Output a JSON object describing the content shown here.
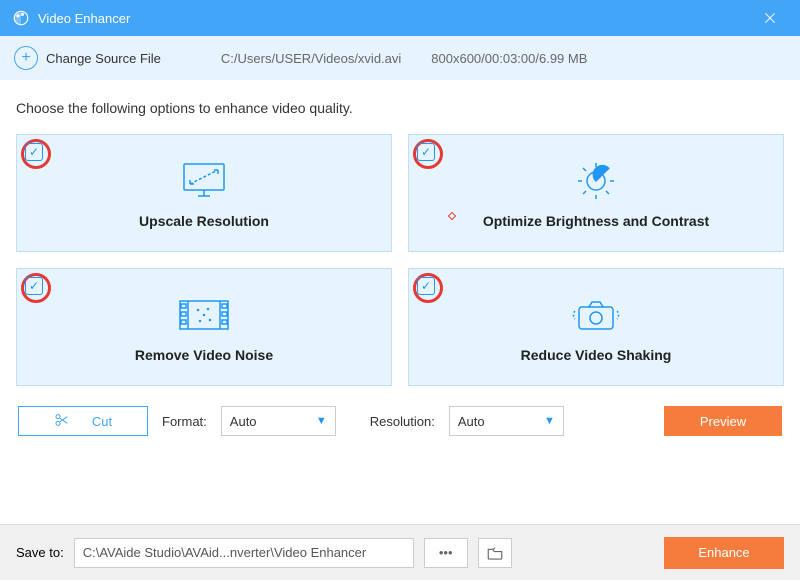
{
  "titlebar": {
    "title": "Video Enhancer"
  },
  "toolbar": {
    "change_source": "Change Source File",
    "filepath": "C:/Users/USER/Videos/xvid.avi",
    "fileinfo": "800x600/00:03:00/6.99 MB"
  },
  "instruction": "Choose the following options to enhance video quality.",
  "cards": {
    "upscale": "Upscale Resolution",
    "brightness": "Optimize Brightness and Contrast",
    "noise": "Remove Video Noise",
    "shaking": "Reduce Video Shaking"
  },
  "controls": {
    "cut": "Cut",
    "format_label": "Format:",
    "format_value": "Auto",
    "resolution_label": "Resolution:",
    "resolution_value": "Auto",
    "preview": "Preview"
  },
  "footer": {
    "save_label": "Save to:",
    "save_path": "C:\\AVAide Studio\\AVAid...nverter\\Video Enhancer",
    "enhance": "Enhance"
  }
}
